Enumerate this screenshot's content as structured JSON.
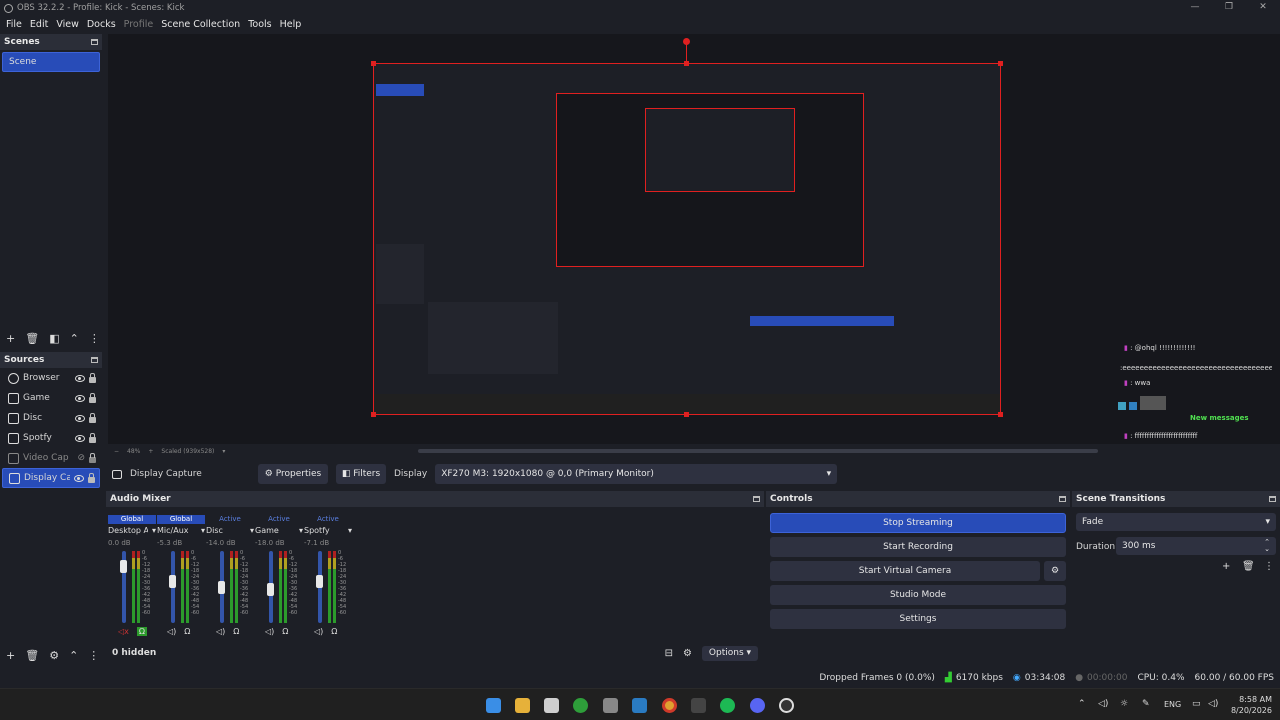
{
  "window": {
    "title": "OBS 32.2.2 - Profile: Kick - Scenes: Kick"
  },
  "menu": [
    "File",
    "Edit",
    "View",
    "Docks",
    "Profile",
    "Scene Collection",
    "Tools",
    "Help"
  ],
  "scenes": {
    "title": "Scenes",
    "items": [
      "Scene"
    ]
  },
  "sources": {
    "title": "Sources",
    "items": [
      {
        "name": "Browser",
        "icon": "browser-icon"
      },
      {
        "name": "Game",
        "icon": "game-capture-icon"
      },
      {
        "name": "Disc",
        "icon": "window-capture-icon"
      },
      {
        "name": "Spotfy",
        "icon": "window-capture-icon"
      },
      {
        "name": "Video Cap",
        "icon": "camera-icon",
        "hidden": true
      },
      {
        "name": "Display Ca",
        "icon": "monitor-icon",
        "selected": true
      }
    ],
    "hidden_label": "0 hidden"
  },
  "preview": {
    "zoom": "48%",
    "scaled": "Scaled (939x528)",
    "chat": [
      {
        "user": "@ohql",
        "text": ": @ohql !!!!!!!!!!!!!"
      },
      {
        "text": ":eeeeeeeeeeeeeeeeeeeeeeeeeeeeeeeeeeeeeeeeeeeeeeeeeeeeee"
      },
      {
        "text": ": wwa"
      },
      {
        "text": "New messages"
      },
      {
        "text": ": ffffffffffffffffffffffffff"
      }
    ]
  },
  "context": {
    "source_name": "Display Capture",
    "properties": "Properties",
    "filters": "Filters",
    "display_label": "Display",
    "display_value": "XF270 M3: 1920x1080 @ 0,0 (Primary Monitor)"
  },
  "mixer": {
    "title": "Audio Mixer",
    "channels": [
      {
        "tag": "Global",
        "name": "Desktop Audio",
        "db": "0.0 dB",
        "level": 0.85
      },
      {
        "tag": "Global",
        "name": "Mic/Aux",
        "db": "-5.3 dB",
        "level": 0.6
      },
      {
        "tag": "Active",
        "name": "Disc",
        "db": "-14.0 dB",
        "level": 0.5
      },
      {
        "tag": "Active",
        "name": "Game",
        "db": "-18.0 dB",
        "level": 0.45
      },
      {
        "tag": "Active",
        "name": "Spotfy",
        "db": "-7.1 dB",
        "level": 0.6
      }
    ],
    "scale": [
      "0",
      "-6",
      "-12",
      "-18",
      "-24",
      "-30",
      "-36",
      "-42",
      "-48",
      "-54",
      "-60"
    ],
    "options": "Options"
  },
  "controls": {
    "title": "Controls",
    "stop_streaming": "Stop Streaming",
    "start_recording": "Start Recording",
    "start_virtual_camera": "Start Virtual Camera",
    "studio_mode": "Studio Mode",
    "settings": "Settings"
  },
  "transitions": {
    "title": "Scene Transitions",
    "selected": "Fade",
    "duration_label": "Duration",
    "duration_value": "300 ms"
  },
  "status": {
    "dropped": "Dropped Frames 0 (0.0%)",
    "bitrate": "6170 kbps",
    "stream_time": "03:34:08",
    "rec_time": "00:00:00",
    "cpu": "CPU: 0.4%",
    "fps": "60.00 / 60.00 FPS"
  },
  "taskbar": {
    "lang": "ENG",
    "time": "8:58 AM",
    "date": "8/20/2026"
  },
  "colors": {
    "accent": "#284cb8",
    "record_red": "#e02020",
    "bg": "#1d1f26"
  }
}
